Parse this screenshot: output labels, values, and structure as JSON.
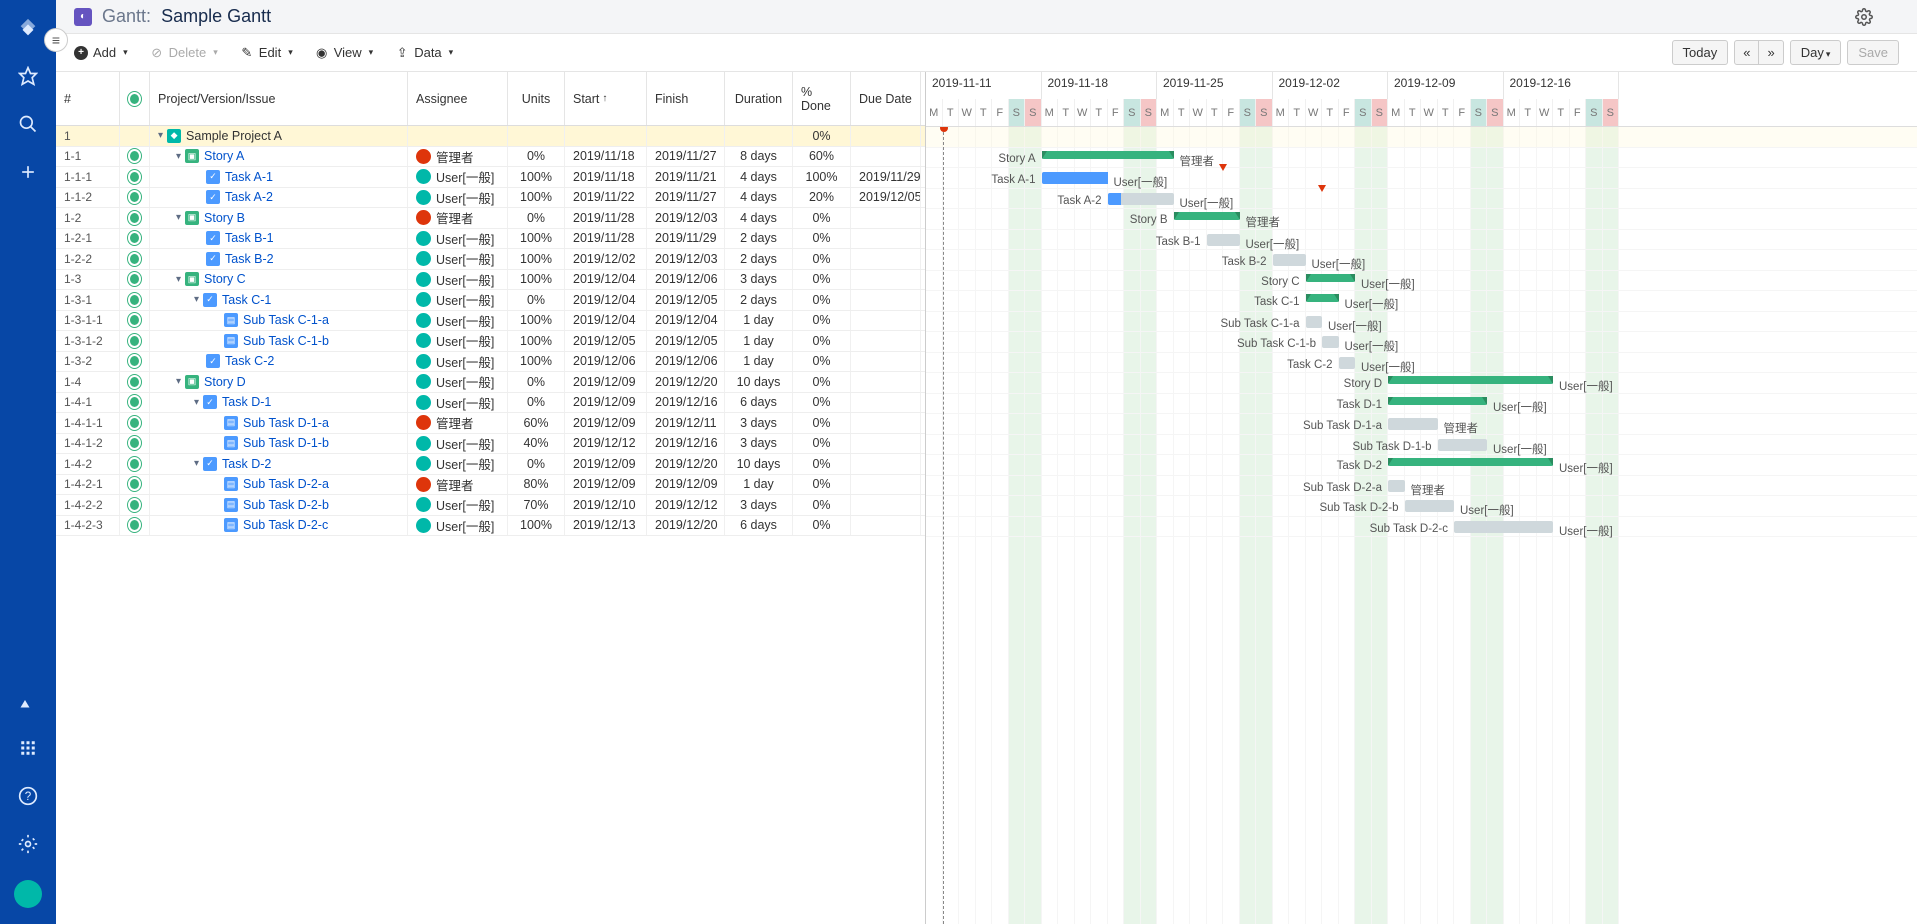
{
  "header": {
    "app_type": "Gantt",
    "title": "Sample Gantt"
  },
  "toolbar": {
    "add": "Add",
    "delete": "Delete",
    "edit": "Edit",
    "view": "View",
    "data": "Data",
    "today": "Today",
    "scale": "Day",
    "save": "Save"
  },
  "columns": {
    "num": "#",
    "name": "Project/Version/Issue",
    "assignee": "Assignee",
    "units": "Units",
    "start": "Start",
    "finish": "Finish",
    "duration": "Duration",
    "done": "% Done",
    "due": "Due Date"
  },
  "weeks": [
    "2019-11-11",
    "2019-11-18",
    "2019-11-25",
    "2019-12-02",
    "2019-12-09",
    "2019-12-16"
  ],
  "day_labels": [
    "M",
    "T",
    "W",
    "T",
    "F",
    "S",
    "S"
  ],
  "day_width": 16.5,
  "start_offset_days": 0,
  "today_day": 1,
  "rows": [
    {
      "num": "1",
      "type": "project",
      "level": 0,
      "name": "Sample Project A",
      "done": "0%",
      "is_project": true,
      "expanded": true
    },
    {
      "num": "1-1",
      "type": "story",
      "level": 1,
      "name": "Story A",
      "assignee": "管理者",
      "av": "admin",
      "units": "0%",
      "start": "2019/11/18",
      "finish": "2019/11/27",
      "duration": "8 days",
      "done": "60%",
      "expanded": true,
      "bar": {
        "start": 7,
        "len": 8,
        "type": "parent"
      }
    },
    {
      "num": "1-1-1",
      "type": "task",
      "level": 2,
      "name": "Task A-1",
      "assignee": "User[一般]",
      "av": "user",
      "units": "100%",
      "start": "2019/11/18",
      "finish": "2019/11/21",
      "duration": "4 days",
      "done": "100%",
      "due": "2019/11/29",
      "bar": {
        "start": 7,
        "len": 4,
        "type": "task",
        "progress": 100
      },
      "deadline": 18
    },
    {
      "num": "1-1-2",
      "type": "task",
      "level": 2,
      "name": "Task A-2",
      "assignee": "User[一般]",
      "av": "user",
      "units": "100%",
      "start": "2019/11/22",
      "finish": "2019/11/27",
      "duration": "4 days",
      "done": "20%",
      "due": "2019/12/05",
      "bar": {
        "start": 11,
        "len": 4,
        "type": "task",
        "progress": 20
      },
      "deadline": 24
    },
    {
      "num": "1-2",
      "type": "story",
      "level": 1,
      "name": "Story B",
      "assignee": "管理者",
      "av": "admin",
      "units": "0%",
      "start": "2019/11/28",
      "finish": "2019/12/03",
      "duration": "4 days",
      "done": "0%",
      "expanded": true,
      "bar": {
        "start": 15,
        "len": 4,
        "type": "parent"
      }
    },
    {
      "num": "1-2-1",
      "type": "task",
      "level": 2,
      "name": "Task B-1",
      "assignee": "User[一般]",
      "av": "user",
      "units": "100%",
      "start": "2019/11/28",
      "finish": "2019/11/29",
      "duration": "2 days",
      "done": "0%",
      "bar": {
        "start": 17,
        "len": 2,
        "type": "task",
        "progress": 0
      }
    },
    {
      "num": "1-2-2",
      "type": "task",
      "level": 2,
      "name": "Task B-2",
      "assignee": "User[一般]",
      "av": "user",
      "units": "100%",
      "start": "2019/12/02",
      "finish": "2019/12/03",
      "duration": "2 days",
      "done": "0%",
      "bar": {
        "start": 21,
        "len": 2,
        "type": "task",
        "progress": 0
      }
    },
    {
      "num": "1-3",
      "type": "story",
      "level": 1,
      "name": "Story C",
      "assignee": "User[一般]",
      "av": "user",
      "units": "100%",
      "start": "2019/12/04",
      "finish": "2019/12/06",
      "duration": "3 days",
      "done": "0%",
      "expanded": true,
      "bar": {
        "start": 23,
        "len": 3,
        "type": "parent"
      }
    },
    {
      "num": "1-3-1",
      "type": "task",
      "level": 2,
      "name": "Task C-1",
      "assignee": "User[一般]",
      "av": "user",
      "units": "0%",
      "start": "2019/12/04",
      "finish": "2019/12/05",
      "duration": "2 days",
      "done": "0%",
      "expanded": true,
      "bar": {
        "start": 23,
        "len": 2,
        "type": "parent"
      }
    },
    {
      "num": "1-3-1-1",
      "type": "subtask",
      "level": 3,
      "name": "Sub Task C-1-a",
      "assignee": "User[一般]",
      "av": "user",
      "units": "100%",
      "start": "2019/12/04",
      "finish": "2019/12/04",
      "duration": "1 day",
      "done": "0%",
      "bar": {
        "start": 23,
        "len": 1,
        "type": "task",
        "progress": 0
      }
    },
    {
      "num": "1-3-1-2",
      "type": "subtask",
      "level": 3,
      "name": "Sub Task C-1-b",
      "assignee": "User[一般]",
      "av": "user",
      "units": "100%",
      "start": "2019/12/05",
      "finish": "2019/12/05",
      "duration": "1 day",
      "done": "0%",
      "bar": {
        "start": 24,
        "len": 1,
        "type": "task",
        "progress": 0
      }
    },
    {
      "num": "1-3-2",
      "type": "task",
      "level": 2,
      "name": "Task C-2",
      "assignee": "User[一般]",
      "av": "user",
      "units": "100%",
      "start": "2019/12/06",
      "finish": "2019/12/06",
      "duration": "1 day",
      "done": "0%",
      "bar": {
        "start": 25,
        "len": 1,
        "type": "task",
        "progress": 0
      }
    },
    {
      "num": "1-4",
      "type": "story",
      "level": 1,
      "name": "Story D",
      "assignee": "User[一般]",
      "av": "user",
      "units": "0%",
      "start": "2019/12/09",
      "finish": "2019/12/20",
      "duration": "10 days",
      "done": "0%",
      "expanded": true,
      "bar": {
        "start": 28,
        "len": 10,
        "type": "parent"
      }
    },
    {
      "num": "1-4-1",
      "type": "task",
      "level": 2,
      "name": "Task D-1",
      "assignee": "User[一般]",
      "av": "user",
      "units": "0%",
      "start": "2019/12/09",
      "finish": "2019/12/16",
      "duration": "6 days",
      "done": "0%",
      "expanded": true,
      "bar": {
        "start": 28,
        "len": 6,
        "type": "parent"
      }
    },
    {
      "num": "1-4-1-1",
      "type": "subtask",
      "level": 3,
      "name": "Sub Task D-1-a",
      "assignee": "管理者",
      "av": "admin",
      "units": "60%",
      "start": "2019/12/09",
      "finish": "2019/12/11",
      "duration": "3 days",
      "done": "0%",
      "bar": {
        "start": 28,
        "len": 3,
        "type": "task",
        "progress": 0
      }
    },
    {
      "num": "1-4-1-2",
      "type": "subtask",
      "level": 3,
      "name": "Sub Task D-1-b",
      "assignee": "User[一般]",
      "av": "user",
      "units": "40%",
      "start": "2019/12/12",
      "finish": "2019/12/16",
      "duration": "3 days",
      "done": "0%",
      "bar": {
        "start": 31,
        "len": 3,
        "type": "task",
        "progress": 0
      }
    },
    {
      "num": "1-4-2",
      "type": "task",
      "level": 2,
      "name": "Task D-2",
      "assignee": "User[一般]",
      "av": "user",
      "units": "0%",
      "start": "2019/12/09",
      "finish": "2019/12/20",
      "duration": "10 days",
      "done": "0%",
      "expanded": true,
      "bar": {
        "start": 28,
        "len": 10,
        "type": "parent"
      }
    },
    {
      "num": "1-4-2-1",
      "type": "subtask",
      "level": 3,
      "name": "Sub Task D-2-a",
      "assignee": "管理者",
      "av": "admin",
      "units": "80%",
      "start": "2019/12/09",
      "finish": "2019/12/09",
      "duration": "1 day",
      "done": "0%",
      "bar": {
        "start": 28,
        "len": 1,
        "type": "task",
        "progress": 0
      }
    },
    {
      "num": "1-4-2-2",
      "type": "subtask",
      "level": 3,
      "name": "Sub Task D-2-b",
      "assignee": "User[一般]",
      "av": "user",
      "units": "70%",
      "start": "2019/12/10",
      "finish": "2019/12/12",
      "duration": "3 days",
      "done": "0%",
      "bar": {
        "start": 29,
        "len": 3,
        "type": "task",
        "progress": 0
      }
    },
    {
      "num": "1-4-2-3",
      "type": "subtask",
      "level": 3,
      "name": "Sub Task D-2-c",
      "assignee": "User[一般]",
      "av": "user",
      "units": "100%",
      "start": "2019/12/13",
      "finish": "2019/12/20",
      "duration": "6 days",
      "done": "0%",
      "bar": {
        "start": 32,
        "len": 6,
        "type": "task",
        "progress": 0
      }
    }
  ]
}
